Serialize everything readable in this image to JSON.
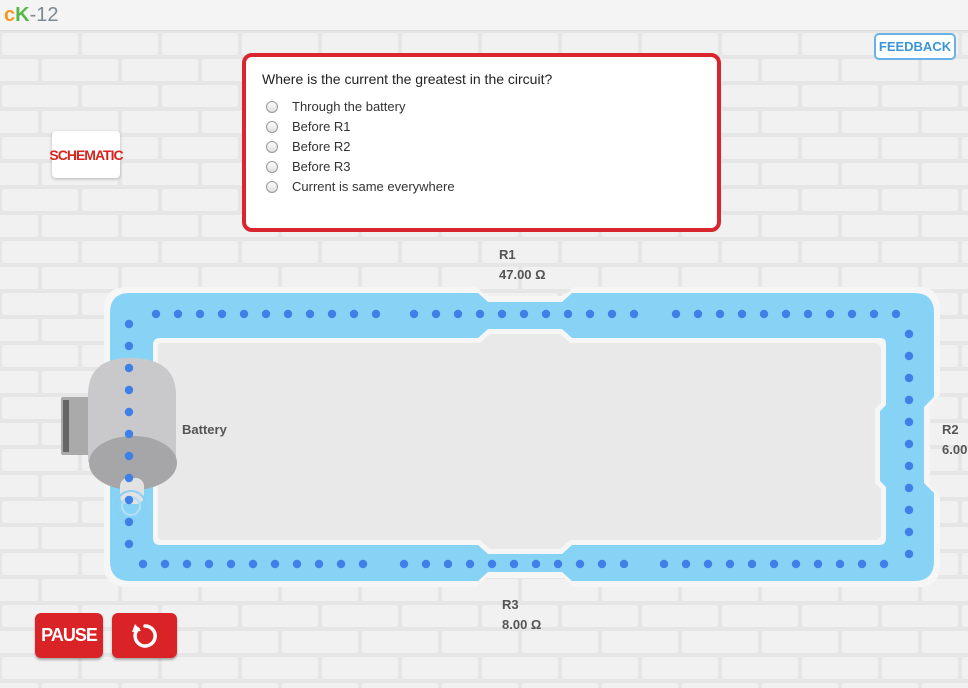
{
  "app": {
    "logo": {
      "c": "c",
      "k": "K",
      "rest": "-12"
    },
    "feedback_label": "FEEDBACK",
    "schematic_label": "SCHEMATIC"
  },
  "question": {
    "text": "Where is the current the greatest in the circuit?",
    "options": [
      "Through the battery",
      "Before R1",
      "Before R2",
      "Before R3",
      "Current is same everywhere"
    ]
  },
  "circuit": {
    "battery_label": "Battery",
    "r1": {
      "name": "R1",
      "value": "47.00 Ω"
    },
    "r2": {
      "name": "R2",
      "value": "6.00"
    },
    "r3": {
      "name": "R3",
      "value": "8.00 Ω"
    }
  },
  "controls": {
    "pause_label": "PAUSE",
    "reset_icon": "reset-icon"
  },
  "colors": {
    "accent_red": "#d9262e",
    "wire_blue": "#87d3f5",
    "dot_blue": "#3f7fe8",
    "feedback_blue": "#3a96d8"
  }
}
